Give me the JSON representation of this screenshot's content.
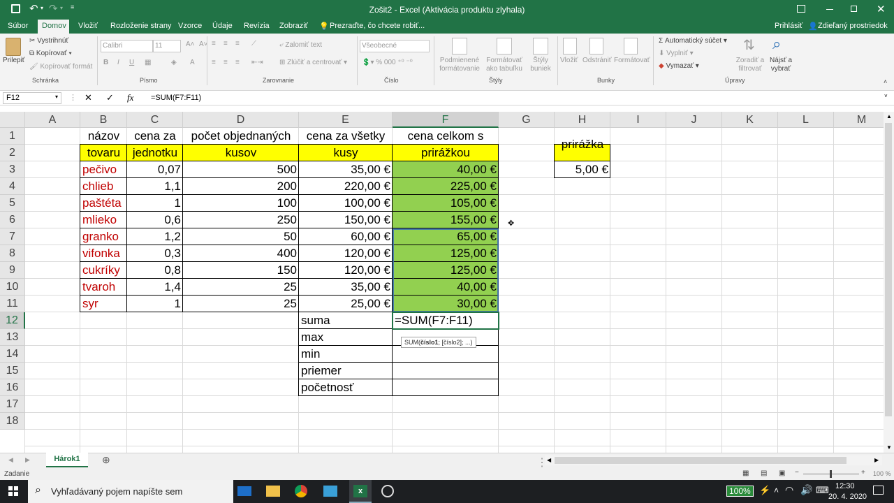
{
  "window": {
    "title": "Zošit2 - Excel (Aktivácia produktu zlyhala)"
  },
  "menu": {
    "tabs": [
      "Súbor",
      "Domov",
      "Vložiť",
      "Rozloženie strany",
      "Vzorce",
      "Údaje",
      "Revízia",
      "Zobraziť"
    ],
    "active": "Domov",
    "tell_me": "Prezraďte, čo chcete robiť...",
    "signin": "Prihlásiť",
    "share": "Zdieľaný prostriedok"
  },
  "ribbon": {
    "clipboard": {
      "paste": "Prilepiť",
      "cut": "Vystrihnúť",
      "copy": "Kopírovať",
      "format_painter": "Kopírovať formát",
      "label": "Schránka"
    },
    "font": {
      "name": "Calibri",
      "size": "11",
      "label": "Písmo",
      "bold": "B",
      "italic": "I",
      "underline": "U"
    },
    "alignment": {
      "wrap": "Zalomiť text",
      "merge": "Zlúčiť a centrovať",
      "label": "Zarovnanie"
    },
    "number": {
      "format": "Všeobecné",
      "label": "Číslo"
    },
    "styles": {
      "conditional": "Podmienené formátovanie",
      "table": "Formátovať ako tabuľku",
      "cell_styles": "Štýly buniek",
      "label": "Štýly"
    },
    "cells": {
      "insert": "Vložiť",
      "delete": "Odstrániť",
      "format": "Formátovať",
      "label": "Bunky"
    },
    "editing": {
      "autosum": "Automatický súčet",
      "fill": "Vyplniť",
      "clear": "Vymazať",
      "sort": "Zoradiť a filtrovať",
      "find": "Nájsť a vybrať",
      "label": "Úpravy"
    }
  },
  "formula_bar": {
    "name_box": "F12",
    "formula": "=SUM(F7:F11)"
  },
  "columns": [
    "A",
    "B",
    "C",
    "D",
    "E",
    "F",
    "G",
    "H",
    "I",
    "J",
    "K",
    "L",
    "M"
  ],
  "rows": [
    "1",
    "2",
    "3",
    "4",
    "5",
    "6",
    "7",
    "8",
    "9",
    "10",
    "11",
    "12",
    "13",
    "14",
    "15",
    "16",
    "17",
    "18"
  ],
  "headers": {
    "b": [
      "názov",
      "tovaru"
    ],
    "c": [
      "cena za",
      "jednotku"
    ],
    "d": [
      "počet objednaných",
      "kusov"
    ],
    "e": [
      "cena za všetky",
      "kusy"
    ],
    "f": [
      "cena celkom s",
      "prirážkou"
    ],
    "h": "prirážka"
  },
  "data": [
    {
      "b": "pečivo",
      "c": "0,07",
      "d": "500",
      "e": "35,00 €",
      "f": "40,00 €"
    },
    {
      "b": "chlieb",
      "c": "1,1",
      "d": "200",
      "e": "220,00 €",
      "f": "225,00 €"
    },
    {
      "b": "paštéta",
      "c": "1",
      "d": "100",
      "e": "100,00 €",
      "f": "105,00 €"
    },
    {
      "b": "mlieko",
      "c": "0,6",
      "d": "250",
      "e": "150,00 €",
      "f": "155,00 €"
    },
    {
      "b": "granko",
      "c": "1,2",
      "d": "50",
      "e": "60,00 €",
      "f": "65,00 €"
    },
    {
      "b": "vifonka",
      "c": "0,3",
      "d": "400",
      "e": "120,00 €",
      "f": "125,00 €"
    },
    {
      "b": "cukríky",
      "c": "0,8",
      "d": "150",
      "e": "120,00 €",
      "f": "125,00 €"
    },
    {
      "b": "tvaroh",
      "c": "1,4",
      "d": "25",
      "e": "35,00 €",
      "f": "40,00 €"
    },
    {
      "b": "syr",
      "c": "1",
      "d": "25",
      "e": "25,00 €",
      "f": "30,00 €"
    }
  ],
  "h3": "5,00 €",
  "stats": [
    "suma",
    "max",
    "min",
    "priemer",
    "početnosť"
  ],
  "editing_cell": "=SUM(F7:F11)",
  "tooltip": {
    "fn": "SUM(",
    "arg1": "číslo1",
    "rest": "; [číslo2]; ...)"
  },
  "sheet_tab": "Hárok1",
  "status": {
    "mode": "Zadanie",
    "zoom": "100 %"
  },
  "taskbar": {
    "search": "Vyhľadávaný pojem napíšte sem",
    "battery": "100%",
    "time": "12:30",
    "date": "20. 4. 2020"
  },
  "colors": {
    "excel_green": "#217346",
    "yellow": "#ffff00",
    "green_fill": "#92d050",
    "red_text": "#c00000"
  }
}
